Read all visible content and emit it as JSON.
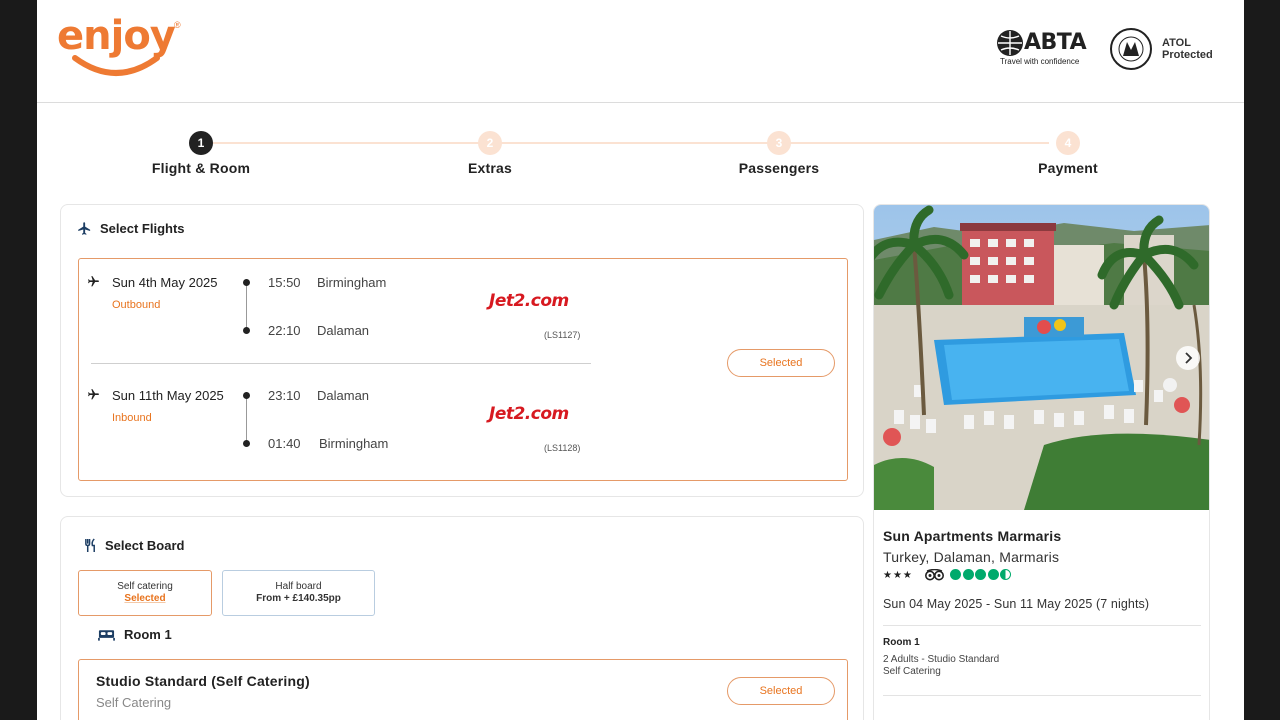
{
  "header": {
    "logo_text": "enjoy",
    "logo_reg": "®",
    "abta_name": "ABTA",
    "abta_tagline": "Travel with confidence",
    "atol_line1": "ATOL",
    "atol_line2": "Protected"
  },
  "steps": [
    {
      "number": "1",
      "label": "Flight & Room",
      "active": true
    },
    {
      "number": "2",
      "label": "Extras",
      "active": false
    },
    {
      "number": "3",
      "label": "Passengers",
      "active": false
    },
    {
      "number": "4",
      "label": "Payment",
      "active": false
    }
  ],
  "flights": {
    "title": "Select Flights",
    "button_label": "Selected",
    "legs": [
      {
        "date": "Sun 4th May 2025",
        "direction": "Outbound",
        "depart_time": "15:50",
        "depart_place": "Birmingham",
        "arrive_time": "22:10",
        "arrive_place": "Dalaman",
        "airline": "Jet2.com",
        "flight_no": "(LS1127)"
      },
      {
        "date": "Sun 11th May 2025",
        "direction": "Inbound",
        "depart_time": "23:10",
        "depart_place": "Dalaman",
        "arrive_time": "01:40",
        "arrive_place": "Birmingham",
        "airline": "Jet2.com",
        "flight_no": "(LS1128)"
      }
    ]
  },
  "board": {
    "title": "Select Board",
    "options": [
      {
        "name": "Self catering",
        "sub": "Selected",
        "selected": true
      },
      {
        "name": "Half board",
        "sub": "From + £140.35pp",
        "selected": false
      }
    ],
    "room_label": "Room 1",
    "room": {
      "name": "Studio Standard (Self Catering)",
      "board": "Self Catering",
      "button_label": "Selected"
    }
  },
  "hotel": {
    "name": "Sun Apartments Marmaris",
    "location": "Turkey, Dalaman, Marmaris",
    "stars": "★★★",
    "star_count": 3,
    "tripadvisor_rating": 4.5,
    "dates": "Sun 04 May 2025 - Sun 11 May 2025 (7 nights)",
    "room_title": "Room 1",
    "room_line1": "2 Adults - Studio Standard",
    "room_line2": "Self Catering"
  },
  "colors": {
    "brand_orange": "#ee7a33",
    "accent_orange": "#e8741f",
    "jet2_red": "#d71920",
    "tripadvisor_green": "#00aa6c"
  }
}
